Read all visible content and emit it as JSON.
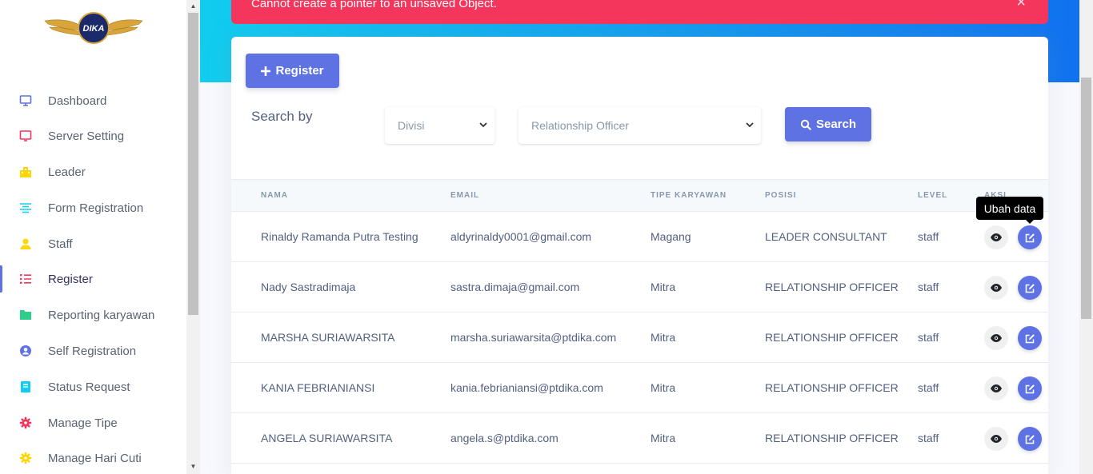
{
  "brand": {
    "logo_text": "DIKA"
  },
  "sidebar": {
    "items": [
      {
        "label": "Dashboard",
        "icon": "monitor-icon",
        "color": "#5e72e4"
      },
      {
        "label": "Server Setting",
        "icon": "tv-icon",
        "color": "#f5365c"
      },
      {
        "label": "Leader",
        "icon": "building-icon",
        "color": "#ffd600"
      },
      {
        "label": "Form Registration",
        "icon": "align-center-icon",
        "color": "#11cdef"
      },
      {
        "label": "Staff",
        "icon": "user-icon",
        "color": "#ffd600"
      },
      {
        "label": "Register",
        "icon": "list-icon",
        "color": "#f5365c"
      },
      {
        "label": "Reporting karyawan",
        "icon": "folder-icon",
        "color": "#2dce89"
      },
      {
        "label": "Self Registration",
        "icon": "user-circle-icon",
        "color": "#5e72e4"
      },
      {
        "label": "Status Request",
        "icon": "archive-icon",
        "color": "#11cdef"
      },
      {
        "label": "Manage Tipe",
        "icon": "settings-icon",
        "color": "#f5365c"
      },
      {
        "label": "Manage Hari Cuti",
        "icon": "settings-icon",
        "color": "#ffd600"
      }
    ],
    "active": "Register"
  },
  "alert": {
    "message": "Cannot create a pointer to an unsaved Object.",
    "close": "×"
  },
  "toolbar": {
    "register_label": "Register",
    "search_by_label": "Search by",
    "filter_field": "Divisi",
    "filter_value": "Relationship Officer",
    "search_label": "Search"
  },
  "table": {
    "headers": [
      "NAMA",
      "EMAIL",
      "TIPE KARYAWAN",
      "POSISI",
      "LEVEL",
      "AKSI"
    ],
    "rows": [
      {
        "nama": "Rinaldy Ramanda Putra Testing",
        "email": "aldyrinaldy0001@gmail.com",
        "tipe": "Magang",
        "posisi": "LEADER CONSULTANT",
        "level": "staff"
      },
      {
        "nama": "Nady Sastradimaja",
        "email": "sastra.dimaja@gmail.com",
        "tipe": "Mitra",
        "posisi": "RELATIONSHIP OFFICER",
        "level": "staff"
      },
      {
        "nama": "MARSHA SURIAWARSITA",
        "email": "marsha.suriawarsita@ptdika.com",
        "tipe": "Mitra",
        "posisi": "RELATIONSHIP OFFICER",
        "level": "staff"
      },
      {
        "nama": "KANIA FEBRIANIANSI",
        "email": "kania.febrianiansi@ptdika.com",
        "tipe": "Mitra",
        "posisi": "RELATIONSHIP OFFICER",
        "level": "staff"
      },
      {
        "nama": "ANGELA SURIAWARSITA",
        "email": "angela.s@ptdika.com",
        "tipe": "Mitra",
        "posisi": "RELATIONSHIP OFFICER",
        "level": "staff"
      }
    ]
  },
  "tooltip": {
    "text": "Ubah data"
  },
  "theme": {
    "primary": "#5e72e4",
    "danger": "#f5365c",
    "info": "#11cdef"
  }
}
